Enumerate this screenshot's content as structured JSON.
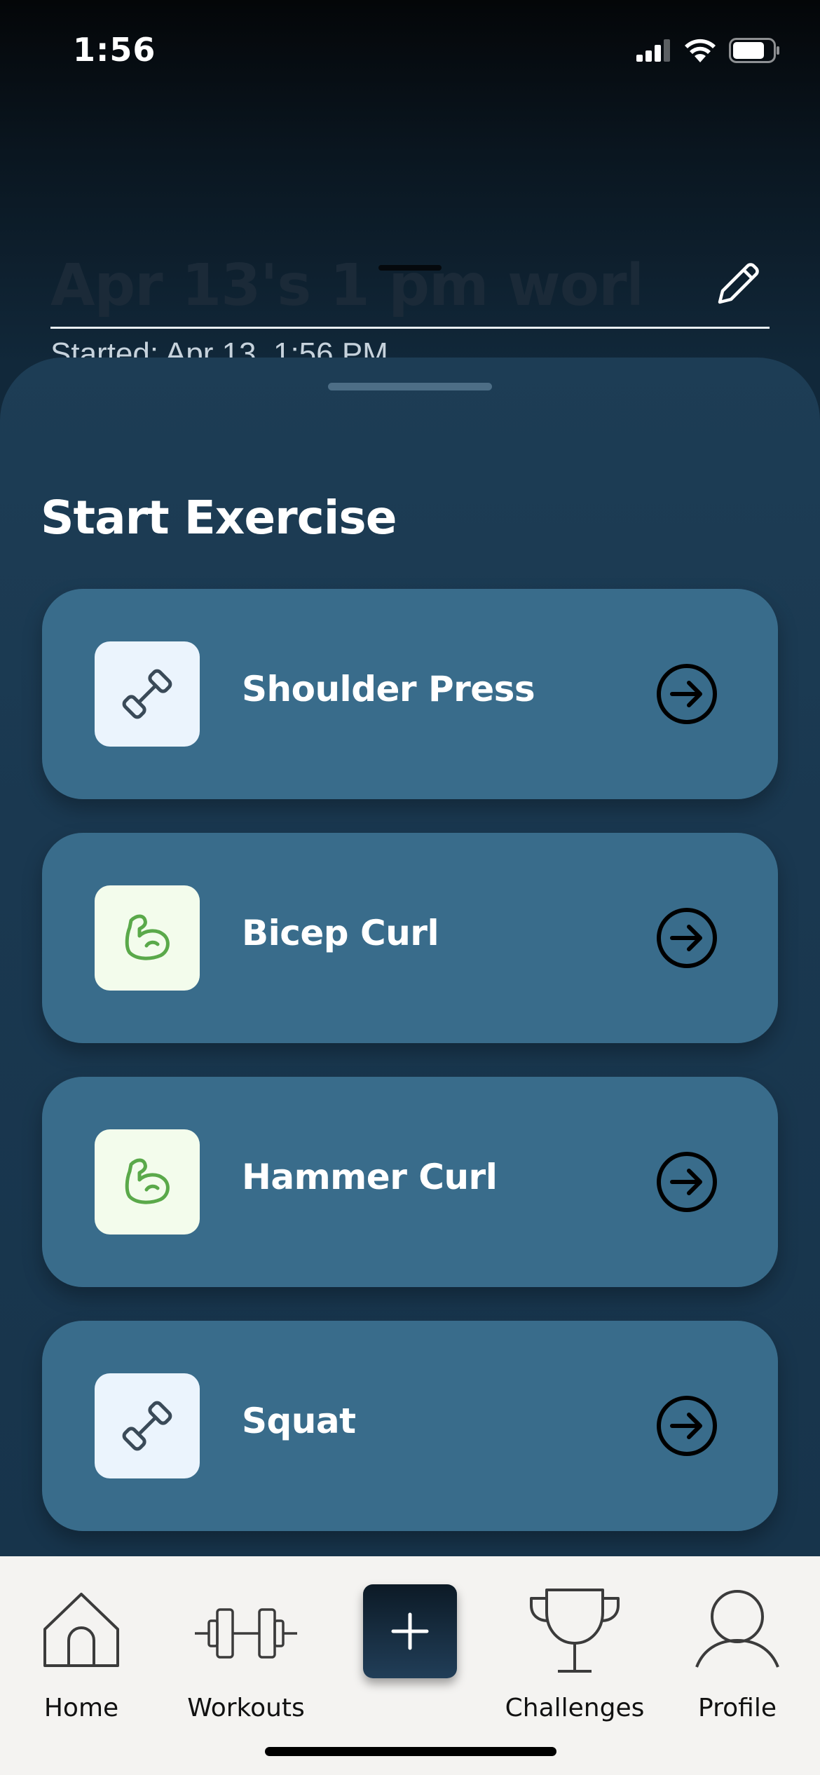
{
  "status_bar": {
    "time": "1:56",
    "icons": [
      "signal-icon",
      "wifi-icon",
      "battery-icon"
    ]
  },
  "workout": {
    "title": "Apr 13's 1 pm work...",
    "started": "Started: Apr 13, 1:56 PM"
  },
  "sheet": {
    "title": "Start Exercise",
    "exercises": [
      {
        "name": "Shoulder Press",
        "icon": "dumbbell-icon",
        "icon_bg": "#ebf4fd"
      },
      {
        "name": "Bicep Curl",
        "icon": "flexed-bicep-icon",
        "icon_bg": "#f3fcec"
      },
      {
        "name": "Hammer Curl",
        "icon": "flexed-bicep-icon",
        "icon_bg": "#f3fcec"
      },
      {
        "name": "Squat",
        "icon": "dumbbell-icon",
        "icon_bg": "#ebf4fd"
      }
    ]
  },
  "tabs": [
    {
      "label": "Home",
      "icon": "home-icon"
    },
    {
      "label": "Workouts",
      "icon": "barbell-icon"
    },
    {
      "label": "",
      "icon": "plus-icon"
    },
    {
      "label": "Challenges",
      "icon": "trophy-icon"
    },
    {
      "label": "Profile",
      "icon": "person-icon"
    }
  ],
  "colors": {
    "card": "#396c8b",
    "sheet": "#1a3850",
    "accent_green": "#5aa94a",
    "icon_dark": "#3a4a58"
  }
}
